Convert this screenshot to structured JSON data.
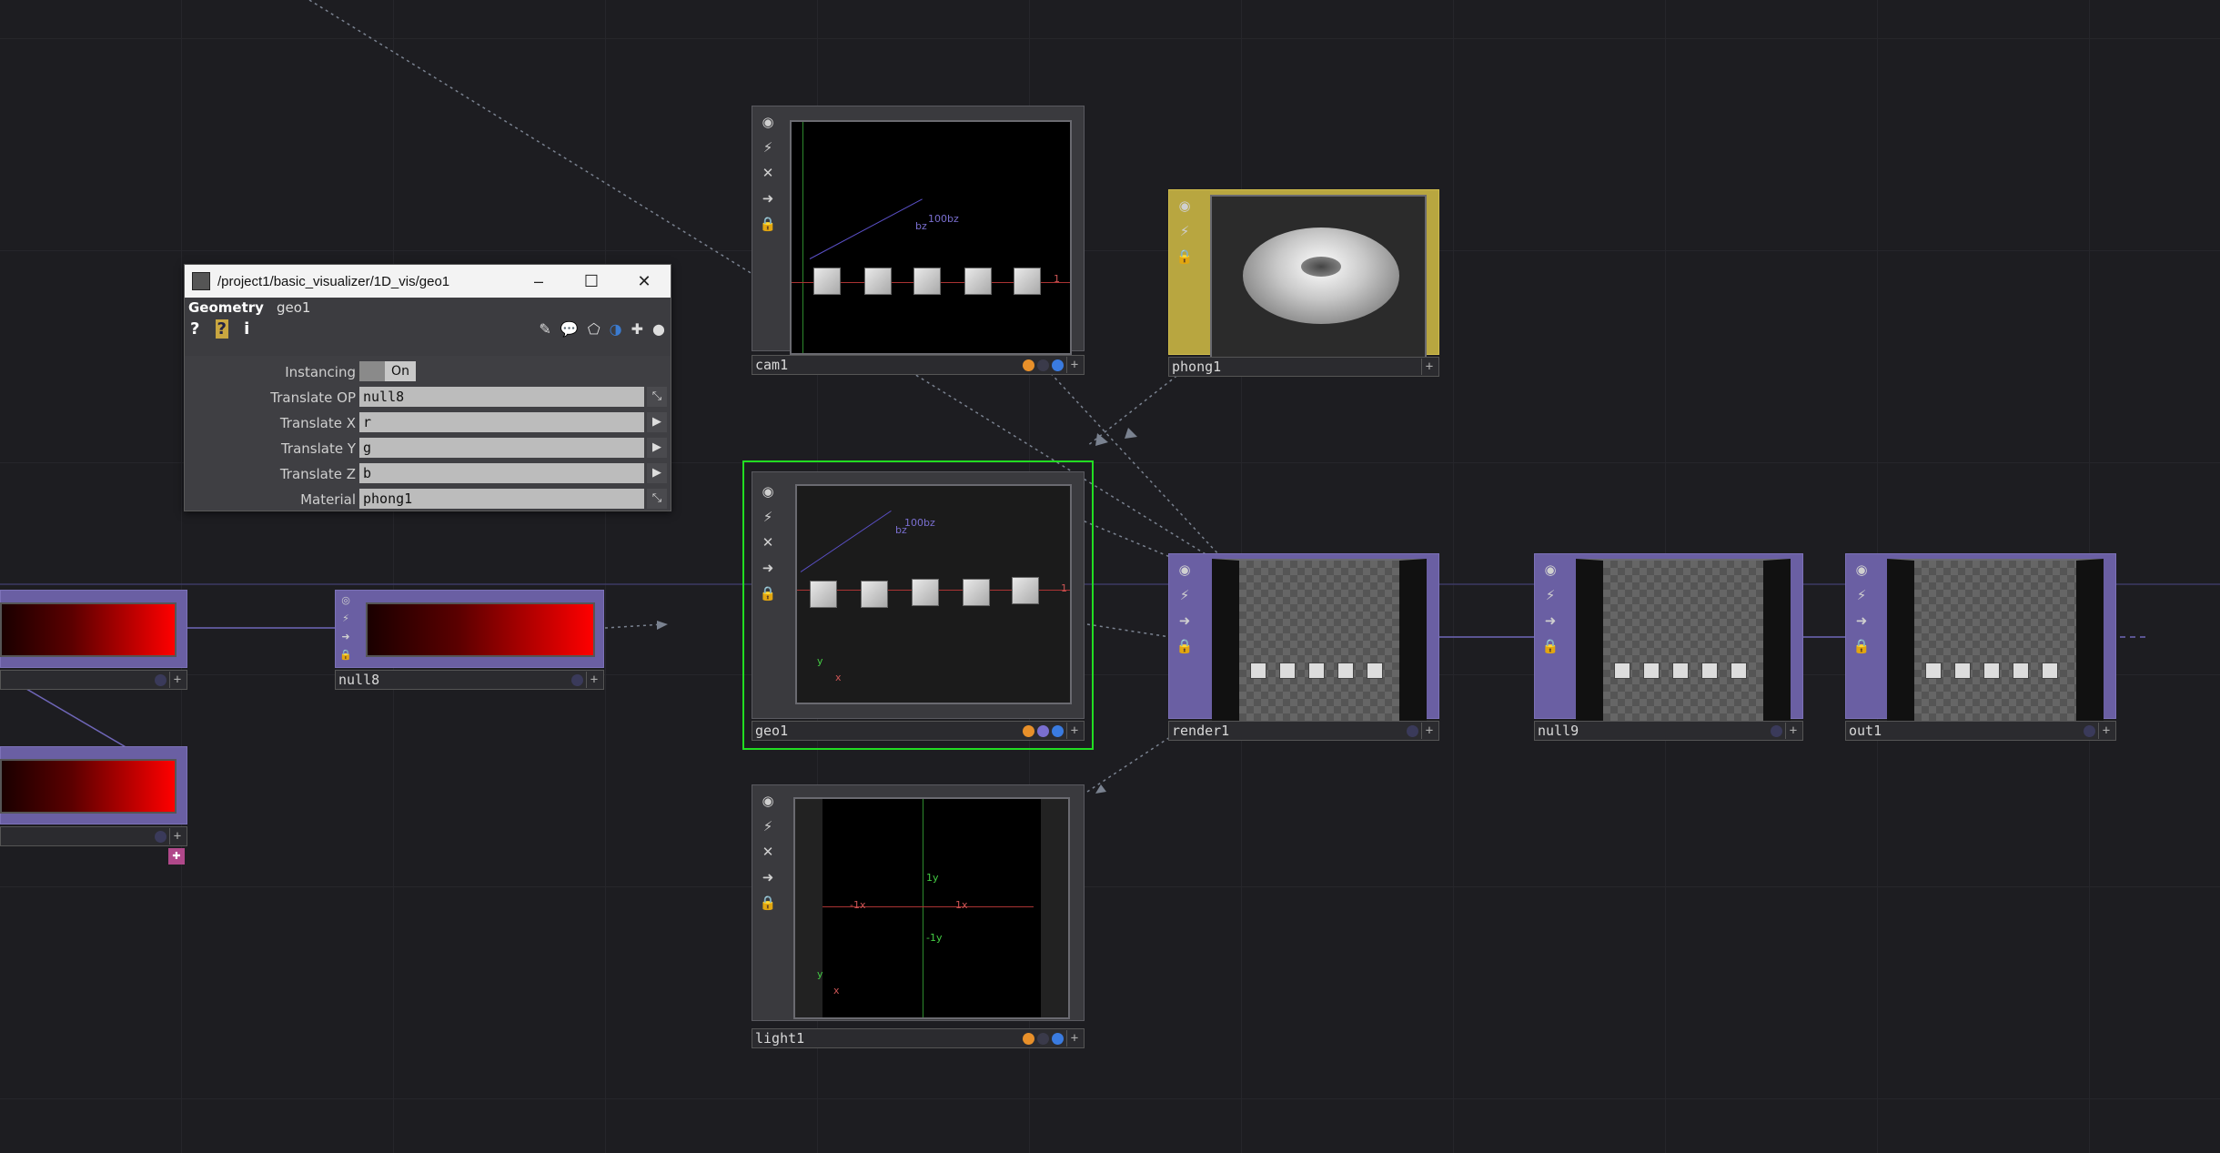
{
  "dialog": {
    "title": "/project1/basic_visualizer/1D_vis/geo1",
    "op_type": "Geometry",
    "op_name": "geo1",
    "help_icons": [
      "?",
      "?",
      "i"
    ],
    "params": [
      {
        "label": "Instancing",
        "value": "On"
      },
      {
        "label": "Translate OP",
        "value": "null8"
      },
      {
        "label": "Translate X",
        "value": "r"
      },
      {
        "label": "Translate Y",
        "value": "g"
      },
      {
        "label": "Translate Z",
        "value": "b"
      },
      {
        "label": "Material",
        "value": "phong1"
      }
    ]
  },
  "nodes": {
    "cam1": {
      "name": "cam1"
    },
    "phong1": {
      "name": "phong1"
    },
    "geo1": {
      "name": "geo1"
    },
    "light1": {
      "name": "light1"
    },
    "render1": {
      "name": "render1"
    },
    "null9": {
      "name": "null9"
    },
    "out1": {
      "name": "out1"
    },
    "null8": {
      "name": "null8"
    }
  },
  "viewer_labels": {
    "cam_axis": "100bz",
    "cam_axis2": "bz",
    "cam_x": "1",
    "geo_axis": "100bz",
    "geo_axis2": "bz",
    "geo_x": "1",
    "light_y_top": "1y",
    "light_y_bottom": "-1y",
    "light_x_left": "-1x",
    "light_x_right": "1x",
    "y": "y",
    "x": "x"
  },
  "colors": {
    "selected_border": "#22dd22",
    "flag_orange": "#e8902a",
    "flag_blue": "#3a7be0",
    "flag_purple": "#7a6fd0"
  }
}
